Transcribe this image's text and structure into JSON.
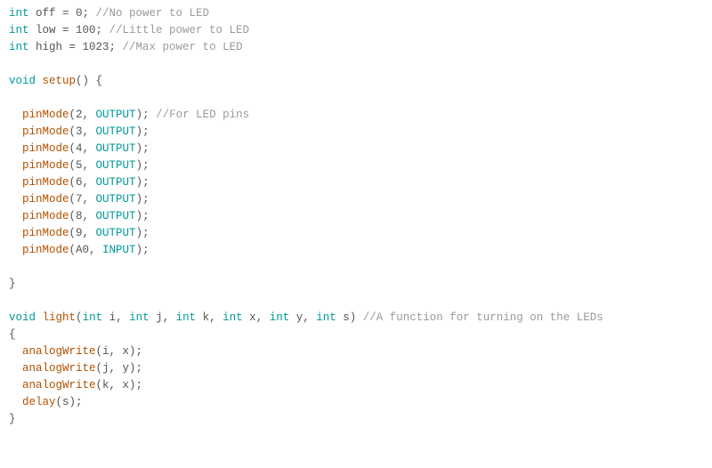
{
  "code": {
    "l1": {
      "kw": "int",
      "a": " off = 0; ",
      "cm": "//No power to LED"
    },
    "l2": {
      "kw": "int",
      "a": " low = 100; ",
      "cm": "//Little power to LED"
    },
    "l3": {
      "kw": "int",
      "a": " high = 1023; ",
      "cm": "//Max power to LED"
    },
    "l4": {
      "t": ""
    },
    "l5": {
      "kw": "void",
      "sp": " ",
      "fn": "setup",
      "a": "() {"
    },
    "l6": {
      "t": ""
    },
    "l7": {
      "in": "  ",
      "fn": "pinMode",
      "a": "(2, ",
      "con": "OUTPUT",
      "b": "); ",
      "cm": "//For LED pins"
    },
    "l8": {
      "in": "  ",
      "fn": "pinMode",
      "a": "(3, ",
      "con": "OUTPUT",
      "b": ");"
    },
    "l9": {
      "in": "  ",
      "fn": "pinMode",
      "a": "(4, ",
      "con": "OUTPUT",
      "b": ");"
    },
    "l10": {
      "in": "  ",
      "fn": "pinMode",
      "a": "(5, ",
      "con": "OUTPUT",
      "b": ");"
    },
    "l11": {
      "in": "  ",
      "fn": "pinMode",
      "a": "(6, ",
      "con": "OUTPUT",
      "b": ");"
    },
    "l12": {
      "in": "  ",
      "fn": "pinMode",
      "a": "(7, ",
      "con": "OUTPUT",
      "b": ");"
    },
    "l13": {
      "in": "  ",
      "fn": "pinMode",
      "a": "(8, ",
      "con": "OUTPUT",
      "b": ");"
    },
    "l14": {
      "in": "  ",
      "fn": "pinMode",
      "a": "(9, ",
      "con": "OUTPUT",
      "b": ");"
    },
    "l15": {
      "in": "  ",
      "fn": "pinMode",
      "a": "(A0, ",
      "con": "INPUT",
      "b": ");"
    },
    "l16": {
      "t": ""
    },
    "l17": {
      "t": "}"
    },
    "l18": {
      "t": ""
    },
    "l19": {
      "kw1": "void",
      "sp1": " ",
      "fn": "light",
      "a": "(",
      "kw2": "int",
      "b": " i, ",
      "kw3": "int",
      "c": " j, ",
      "kw4": "int",
      "d": " k, ",
      "kw5": "int",
      "e": " x, ",
      "kw6": "int",
      "f": " y, ",
      "kw7": "int",
      "g": " s) ",
      "cm": "//A function for turning on the LEDs"
    },
    "l20": {
      "t": "{"
    },
    "l21": {
      "in": "  ",
      "fn": "analogWrite",
      "a": "(i, x);"
    },
    "l22": {
      "in": "  ",
      "fn": "analogWrite",
      "a": "(j, y);"
    },
    "l23": {
      "in": "  ",
      "fn": "analogWrite",
      "a": "(k, x);"
    },
    "l24": {
      "in": "  ",
      "fn": "delay",
      "a": "(s);"
    },
    "l25": {
      "t": "}"
    }
  }
}
